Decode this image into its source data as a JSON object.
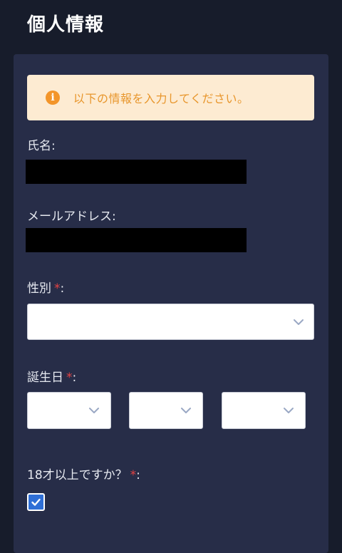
{
  "page": {
    "title": "個人情報"
  },
  "notice": {
    "icon": "info-icon",
    "icon_glyph": "i",
    "text": "以下の情報を入力してください。",
    "accent": "#f3952a",
    "background": "#fdebd2"
  },
  "fields": {
    "name": {
      "label": "氏名:"
    },
    "email": {
      "label": "メールアドレス:"
    },
    "gender": {
      "label": "性別",
      "required_mark": "*",
      "suffix": ":",
      "value": ""
    },
    "birthday": {
      "label": "誕生日",
      "required_mark": "*",
      "suffix": ":",
      "year": "",
      "month": "",
      "day": ""
    },
    "adult": {
      "label": "18才以上ですか？",
      "required_mark": "*",
      "suffix": ":",
      "checked": true
    }
  },
  "colors": {
    "page_background": "#171c2b",
    "card_background": "#272d48",
    "required": "#e54343",
    "checkbox": "#2f6fd6"
  }
}
